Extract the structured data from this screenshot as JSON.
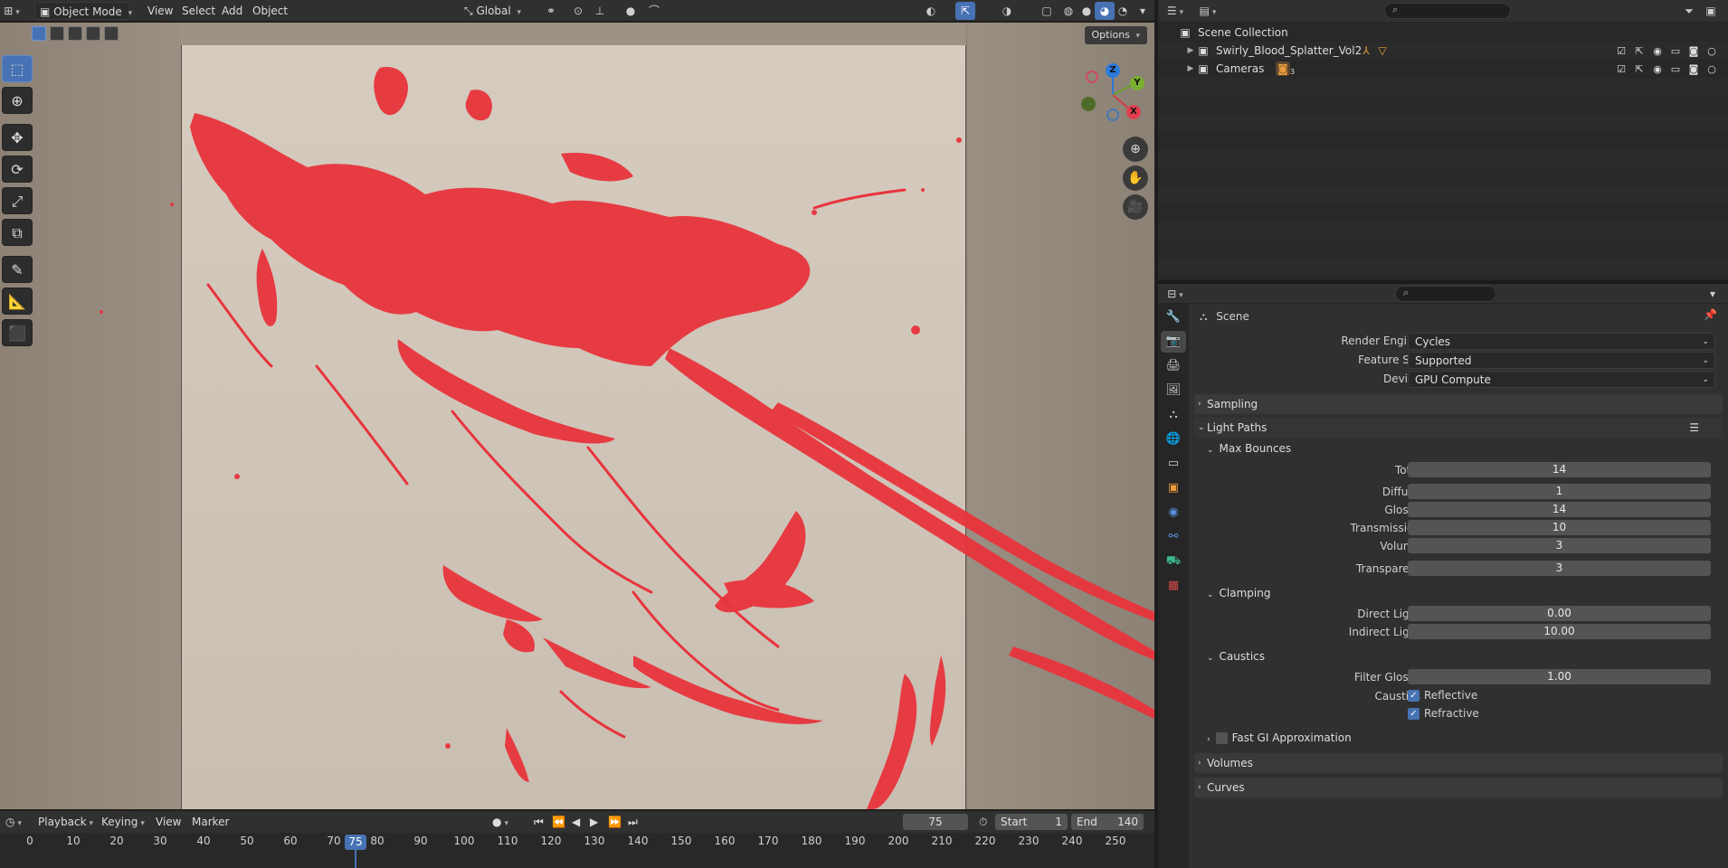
{
  "header": {
    "mode": "Object Mode",
    "menus": [
      "View",
      "Select",
      "Add",
      "Object"
    ],
    "transform_orientation": "Global"
  },
  "viewport": {
    "options_label": "Options",
    "gizmo": {
      "x": "X",
      "y": "Y",
      "z": "Z"
    },
    "splatter_color": "#e8343c"
  },
  "timeline": {
    "menus": {
      "playback": "Playback",
      "keying": "Keying",
      "view": "View",
      "marker": "Marker"
    },
    "current_frame": "75",
    "start_label": "Start",
    "start": "1",
    "end_label": "End",
    "end": "140",
    "ticks": [
      "0",
      "10",
      "20",
      "30",
      "40",
      "50",
      "60",
      "70",
      "80",
      "90",
      "100",
      "110",
      "120",
      "130",
      "140",
      "150",
      "160",
      "170",
      "180",
      "190",
      "200",
      "210",
      "220",
      "230",
      "240",
      "250"
    ]
  },
  "outliner": {
    "root": "Scene Collection",
    "items": [
      {
        "label": "Swirly_Blood_Splatter_Vol2"
      },
      {
        "label": "Cameras",
        "badge": "3"
      }
    ]
  },
  "properties": {
    "context": "Scene",
    "render_engine_label": "Render Engine",
    "render_engine": "Cycles",
    "feature_set_label": "Feature Set",
    "feature_set": "Supported",
    "device_label": "Device",
    "device": "GPU Compute",
    "panels": {
      "sampling": "Sampling",
      "light_paths": "Light Paths",
      "max_bounces": "Max Bounces",
      "clamping": "Clamping",
      "caustics": "Caustics",
      "fast_gi": "Fast GI Approximation",
      "volumes": "Volumes",
      "curves": "Curves"
    },
    "bounces": [
      {
        "label": "Total",
        "value": "14"
      },
      {
        "label": "Diffuse",
        "value": "1"
      },
      {
        "label": "Glossy",
        "value": "14"
      },
      {
        "label": "Transmission",
        "value": "10"
      },
      {
        "label": "Volume",
        "value": "3"
      },
      {
        "label": "Transparent",
        "value": "3"
      }
    ],
    "clamping": [
      {
        "label": "Direct Light",
        "value": "0.00"
      },
      {
        "label": "Indirect Light",
        "value": "10.00"
      }
    ],
    "caustics": {
      "filter_glossy_label": "Filter Glossy",
      "filter_glossy": "1.00",
      "caustics_label": "Caustics",
      "reflective": "Reflective",
      "refractive": "Refractive"
    }
  }
}
